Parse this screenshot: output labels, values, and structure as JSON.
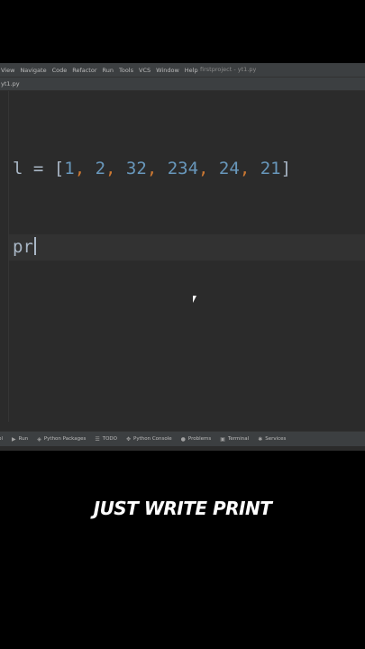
{
  "menubar": {
    "items": [
      "View",
      "Navigate",
      "Code",
      "Refactor",
      "Run",
      "Tools",
      "VCS",
      "Window",
      "Help"
    ],
    "window_title": "firstproject - yt1.py"
  },
  "tabbar": {
    "tab_label": "yt1.py"
  },
  "editor": {
    "line1": {
      "var": "l",
      "op": " = ",
      "open": "[",
      "nums": [
        "1",
        "2",
        "32",
        "234",
        "24",
        "21"
      ],
      "sep": ", ",
      "close": "]"
    },
    "line2": {
      "text": "pr"
    }
  },
  "bottom_toolbar": {
    "items": [
      {
        "label": "rol",
        "icon": ""
      },
      {
        "label": "Run",
        "icon": "▶"
      },
      {
        "label": "Python Packages",
        "icon": "◈"
      },
      {
        "label": "TODO",
        "icon": "☰"
      },
      {
        "label": "Python Console",
        "icon": "✥"
      },
      {
        "label": "Problems",
        "icon": "●"
      },
      {
        "label": "Terminal",
        "icon": "▣"
      },
      {
        "label": "Services",
        "icon": "✱"
      }
    ]
  },
  "caption": {
    "text": "JUST WRITE PRINT"
  },
  "colors": {
    "editor_bg": "#2b2b2b",
    "number": "#6897bb",
    "comma": "#cc7832",
    "text": "#a9b7c6"
  }
}
